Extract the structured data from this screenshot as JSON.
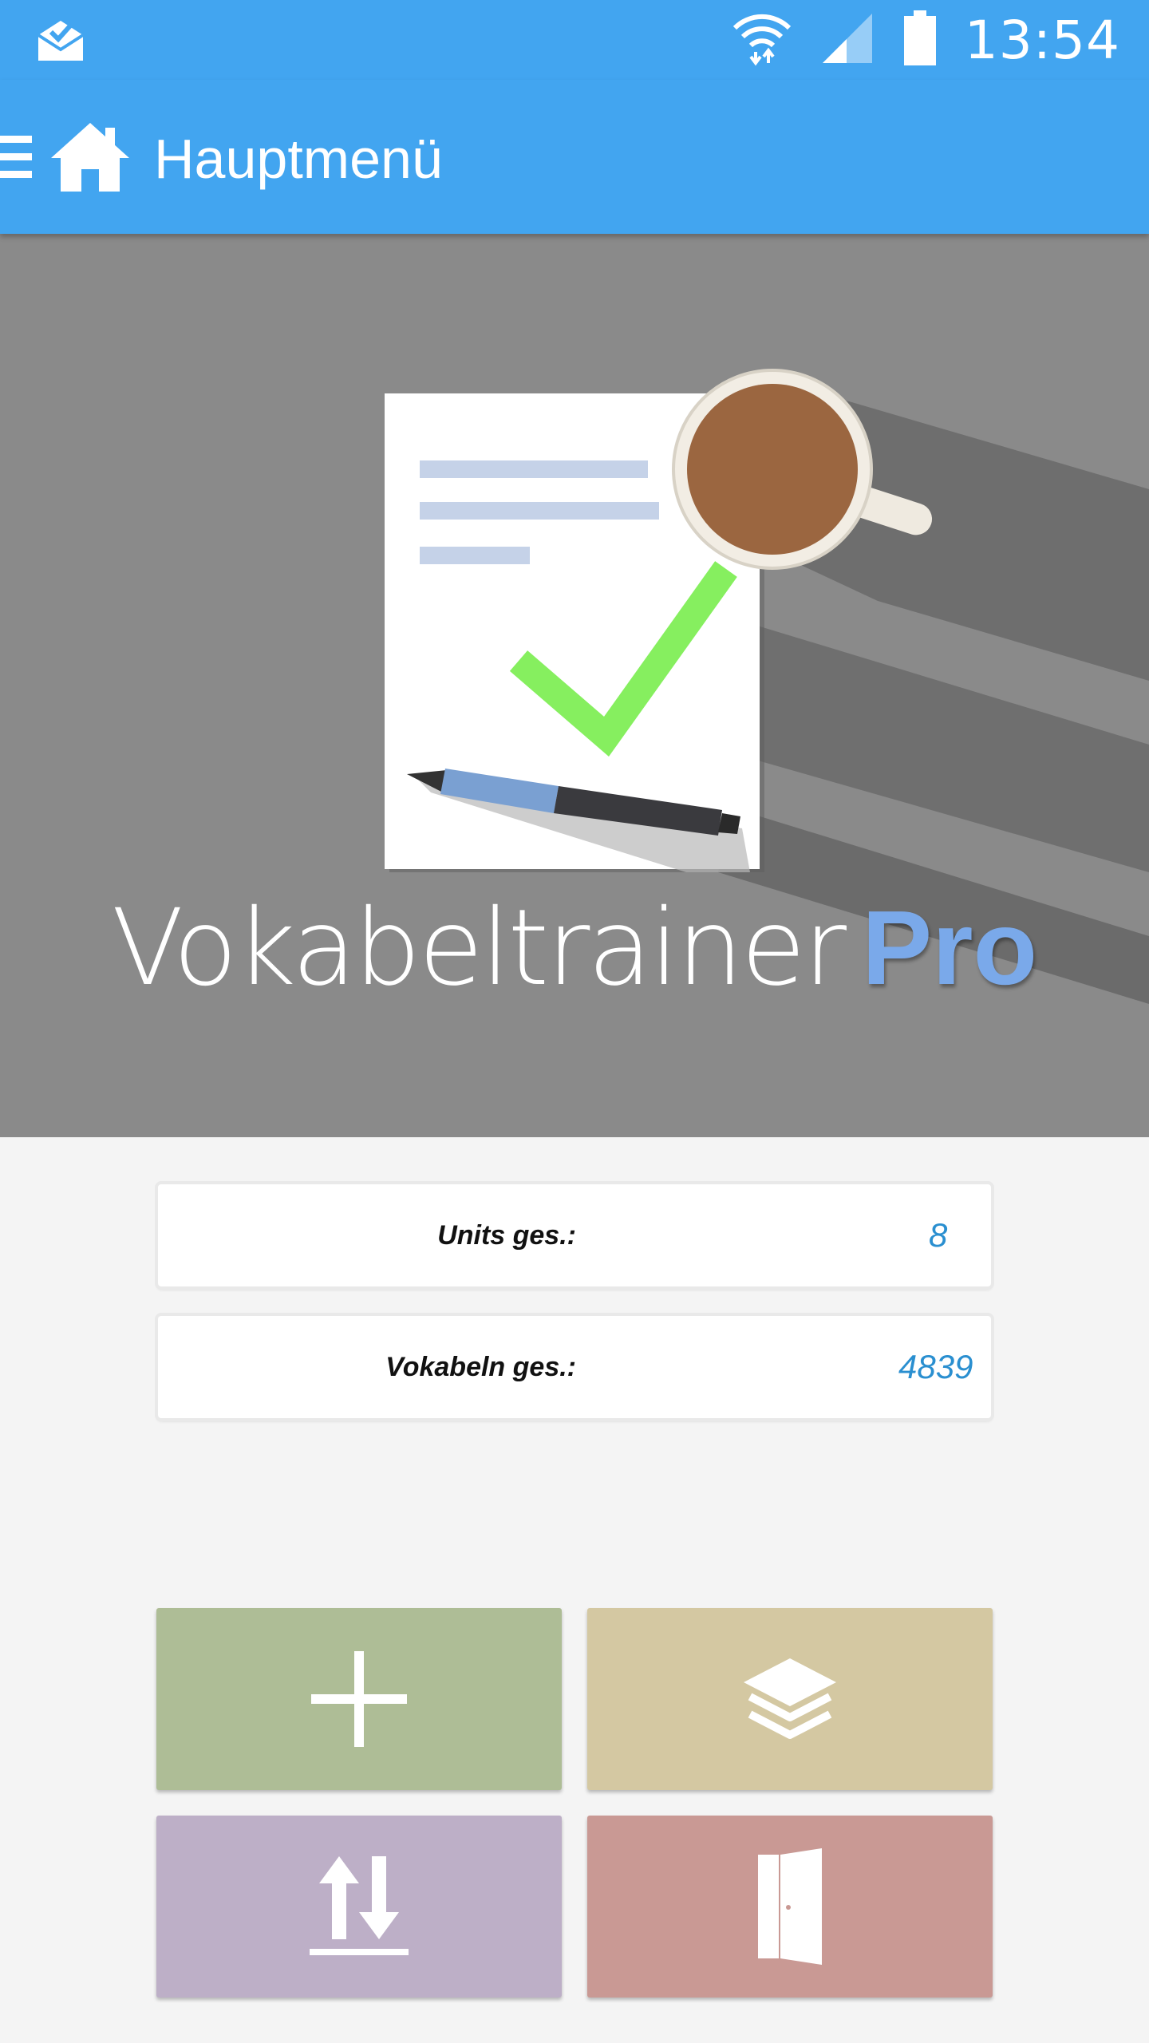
{
  "status_bar": {
    "time": "13:54",
    "icons": [
      "mail-check-icon",
      "wifi-icon",
      "signal-icon",
      "battery-icon"
    ]
  },
  "app_bar": {
    "title": "Hauptmenü",
    "icons": [
      "menu-icon",
      "home-icon"
    ]
  },
  "hero": {
    "title_light": "Vokabeltrainer",
    "title_bold": "Pro"
  },
  "stats": {
    "units_label": "Units ges.:",
    "units_value": "8",
    "vocab_label": "Vokabeln ges.:",
    "vocab_value": "4839"
  },
  "tiles": [
    {
      "icon": "plus-icon",
      "color": "#aebd96"
    },
    {
      "icon": "layers-icon",
      "color": "#d4c8a2"
    },
    {
      "icon": "import-export-icon",
      "color": "#bdafc7"
    },
    {
      "icon": "exit-door-icon",
      "color": "#c99994"
    }
  ],
  "colors": {
    "primary": "#42a5f0",
    "hero_background": "#8a8a8a",
    "accent_pro": "#7aa9ea",
    "stat_value": "#2a8fd0"
  }
}
